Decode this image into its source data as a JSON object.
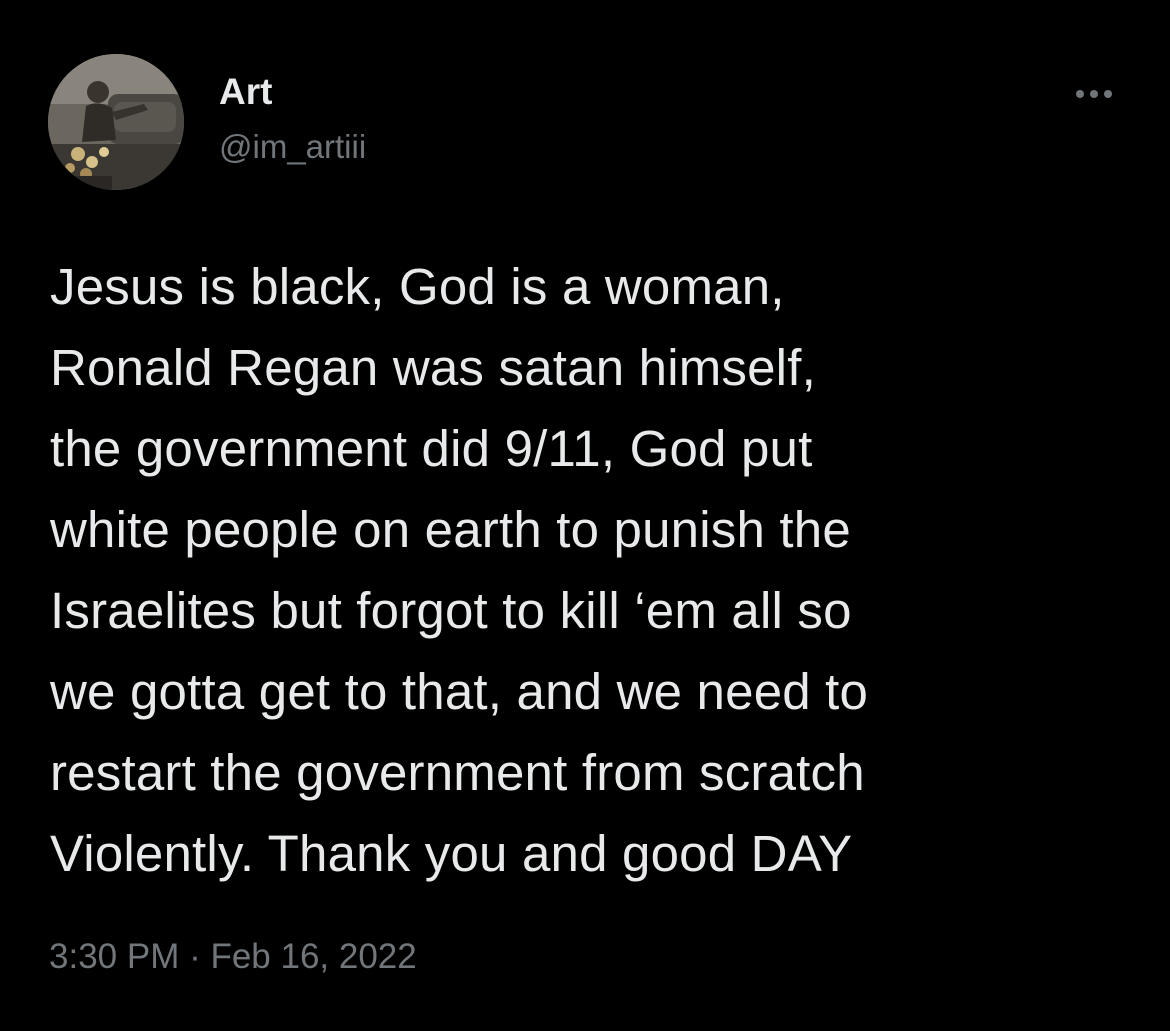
{
  "tweet": {
    "author": {
      "name": "Art",
      "handle": "@im_artiii",
      "avatar_icon": "profile-photo"
    },
    "more_icon": "ellipsis-icon",
    "body_lines": [
      "Jesus is black, God is a woman,",
      "Ronald Regan was satan himself,",
      "the government did 9/11, God put",
      "white people on earth to punish the",
      "Israelites but forgot to kill ‘em all so",
      "we gotta get to that, and we need to",
      "restart the government from scratch",
      "Violently. Thank you and good DAY"
    ],
    "timestamp": "3:30 PM · Feb 16, 2022"
  },
  "colors": {
    "background": "#000000",
    "primary_text": "#e7e9ea",
    "secondary_text": "#71767b"
  }
}
